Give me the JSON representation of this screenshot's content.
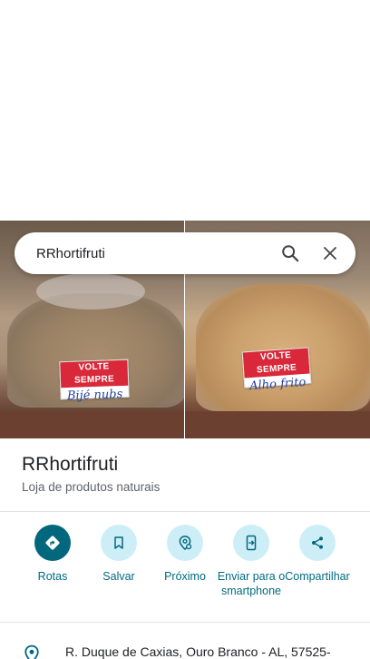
{
  "search": {
    "query": "RRhortifruti"
  },
  "photos": {
    "left": {
      "label_top": "VOLTE SEMPRE",
      "label_hand": "Bijé nubs"
    },
    "right": {
      "label_top": "VOLTE SEMPRE",
      "label_hand": "Alho frito"
    }
  },
  "place": {
    "name": "RRhortifruti",
    "category": "Loja de produtos naturais"
  },
  "actions": [
    {
      "label": "Rotas",
      "icon": "directions-icon"
    },
    {
      "label": "Salvar",
      "icon": "bookmark-icon"
    },
    {
      "label": "Próximo",
      "icon": "nearby-icon"
    },
    {
      "label": "Enviar para o smartphone",
      "icon": "send-to-phone-icon"
    },
    {
      "label": "Compartilhar",
      "icon": "share-icon"
    }
  ],
  "address": {
    "text": "R. Duque de Caxias, Ouro Branco - AL, 57525-"
  },
  "colors": {
    "accent": "#00677d",
    "accent_light": "#cdeef7",
    "action_text": "#006a80"
  }
}
